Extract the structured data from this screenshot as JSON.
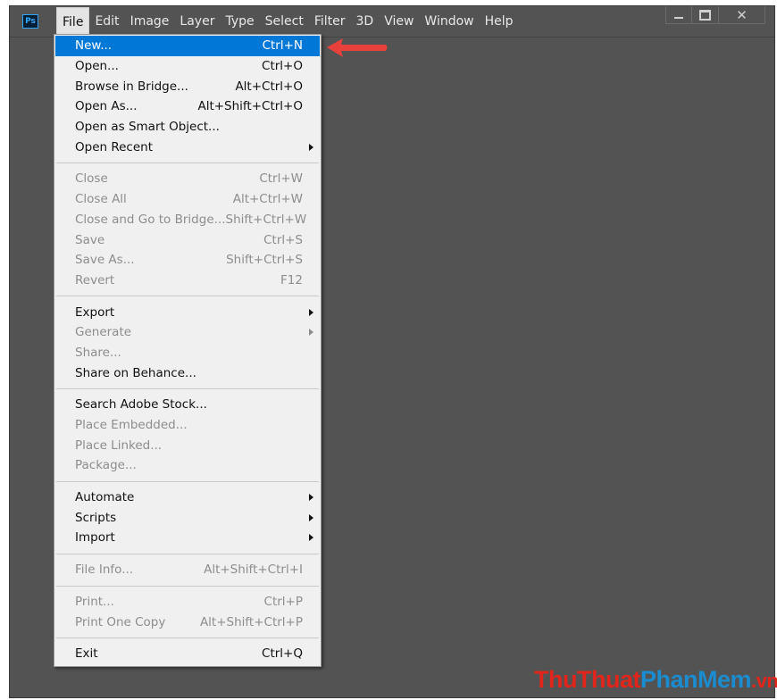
{
  "app": {
    "logo": "Ps"
  },
  "menubar": [
    {
      "label": "File",
      "active": true
    },
    {
      "label": "Edit"
    },
    {
      "label": "Image"
    },
    {
      "label": "Layer"
    },
    {
      "label": "Type"
    },
    {
      "label": "Select"
    },
    {
      "label": "Filter"
    },
    {
      "label": "3D"
    },
    {
      "label": "View"
    },
    {
      "label": "Window"
    },
    {
      "label": "Help"
    }
  ],
  "window_controls": [
    "minimize-icon",
    "maximize-icon",
    "close-icon"
  ],
  "file_menu": {
    "groups": [
      [
        {
          "label": "New...",
          "shortcut": "Ctrl+N",
          "enabled": true,
          "highlighted": true
        },
        {
          "label": "Open...",
          "shortcut": "Ctrl+O",
          "enabled": true
        },
        {
          "label": "Browse in Bridge...",
          "shortcut": "Alt+Ctrl+O",
          "enabled": true
        },
        {
          "label": "Open As...",
          "shortcut": "Alt+Shift+Ctrl+O",
          "enabled": true
        },
        {
          "label": "Open as Smart Object...",
          "shortcut": "",
          "enabled": true
        },
        {
          "label": "Open Recent",
          "shortcut": "",
          "enabled": true,
          "submenu": true
        }
      ],
      [
        {
          "label": "Close",
          "shortcut": "Ctrl+W",
          "enabled": false
        },
        {
          "label": "Close All",
          "shortcut": "Alt+Ctrl+W",
          "enabled": false
        },
        {
          "label": "Close and Go to Bridge...",
          "shortcut": "Shift+Ctrl+W",
          "enabled": false
        },
        {
          "label": "Save",
          "shortcut": "Ctrl+S",
          "enabled": false
        },
        {
          "label": "Save As...",
          "shortcut": "Shift+Ctrl+S",
          "enabled": false
        },
        {
          "label": "Revert",
          "shortcut": "F12",
          "enabled": false
        }
      ],
      [
        {
          "label": "Export",
          "shortcut": "",
          "enabled": true,
          "submenu": true
        },
        {
          "label": "Generate",
          "shortcut": "",
          "enabled": false,
          "submenu": true
        },
        {
          "label": "Share...",
          "shortcut": "",
          "enabled": false
        },
        {
          "label": "Share on Behance...",
          "shortcut": "",
          "enabled": true
        }
      ],
      [
        {
          "label": "Search Adobe Stock...",
          "shortcut": "",
          "enabled": true
        },
        {
          "label": "Place Embedded...",
          "shortcut": "",
          "enabled": false
        },
        {
          "label": "Place Linked...",
          "shortcut": "",
          "enabled": false
        },
        {
          "label": "Package...",
          "shortcut": "",
          "enabled": false
        }
      ],
      [
        {
          "label": "Automate",
          "shortcut": "",
          "enabled": true,
          "submenu": true
        },
        {
          "label": "Scripts",
          "shortcut": "",
          "enabled": true,
          "submenu": true
        },
        {
          "label": "Import",
          "shortcut": "",
          "enabled": true,
          "submenu": true
        }
      ],
      [
        {
          "label": "File Info...",
          "shortcut": "Alt+Shift+Ctrl+I",
          "enabled": false
        }
      ],
      [
        {
          "label": "Print...",
          "shortcut": "Ctrl+P",
          "enabled": false
        },
        {
          "label": "Print One Copy",
          "shortcut": "Alt+Shift+Ctrl+P",
          "enabled": false
        }
      ],
      [
        {
          "label": "Exit",
          "shortcut": "Ctrl+Q",
          "enabled": true
        }
      ]
    ]
  },
  "watermark": {
    "part1": "ThuThuat",
    "part2": "PhanMem",
    "part3": ".vn"
  },
  "colors": {
    "workspace": "#535353",
    "menu_bg": "#f0f0f0",
    "highlight": "#0078d7",
    "annotation_arrow": "#e8413c"
  }
}
